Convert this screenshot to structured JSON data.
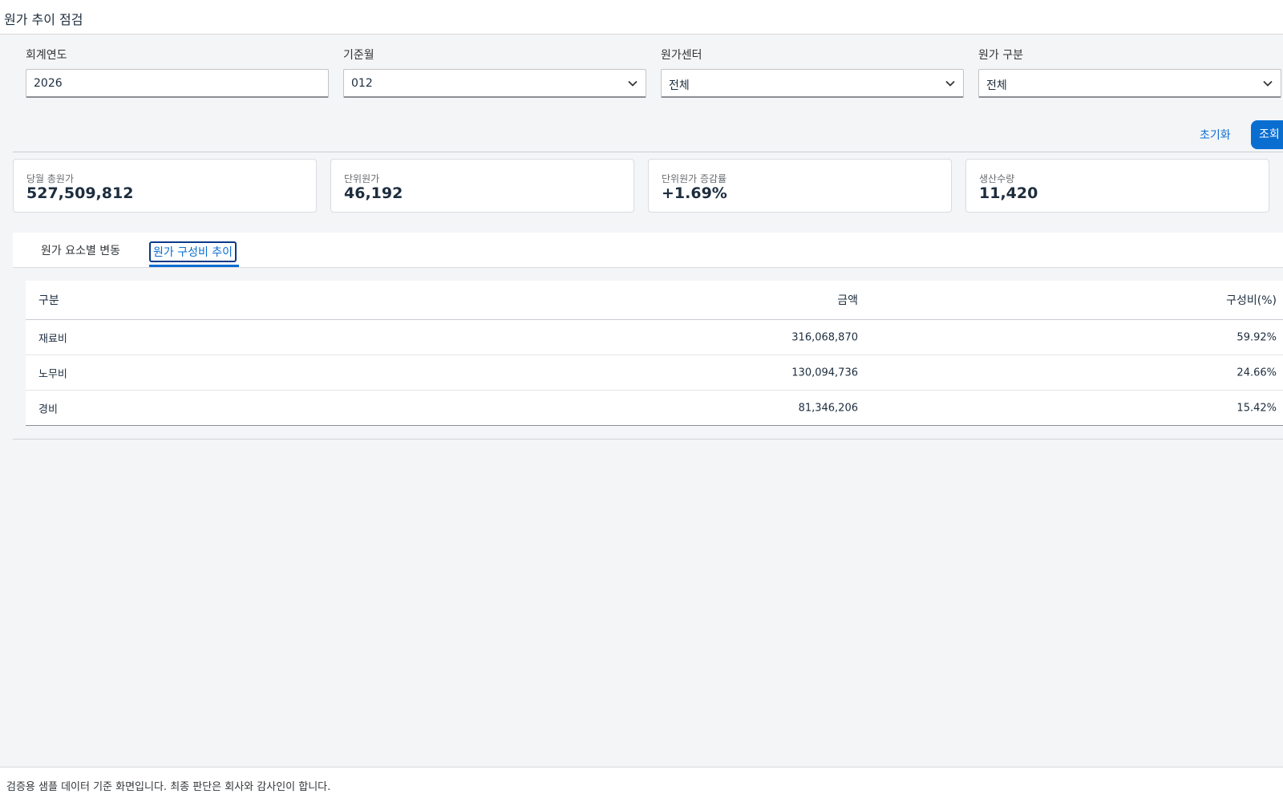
{
  "app": {
    "title": "원가 추이 점검"
  },
  "filters": {
    "fiscal_year": {
      "label": "회계연도",
      "value": "2026"
    },
    "base_month": {
      "label": "기준월",
      "value": "012"
    },
    "cost_center": {
      "label": "원가센터",
      "value": "전체"
    },
    "cost_type": {
      "label": "원가 구분",
      "value": "전체"
    }
  },
  "actions": {
    "reset_label": "초기화",
    "search_label": "조회"
  },
  "kpis": [
    {
      "label": "당월 총원가",
      "value": "527,509,812"
    },
    {
      "label": "단위원가",
      "value": "46,192"
    },
    {
      "label": "단위원가 증감률",
      "value": "+1.69%"
    },
    {
      "label": "생산수량",
      "value": "11,420"
    }
  ],
  "tabs": [
    {
      "label": "원가 요소별 변동",
      "selected": false
    },
    {
      "label": "원가 구성비 추이",
      "selected": true
    }
  ],
  "table": {
    "headers": [
      "구분",
      "금액",
      "구성비(%)"
    ],
    "rows": [
      {
        "category": "재료비",
        "amount": "316,068,870",
        "ratio": "59.92%"
      },
      {
        "category": "노무비",
        "amount": "130,094,736",
        "ratio": "24.66%"
      },
      {
        "category": "경비",
        "amount": "81,346,206",
        "ratio": "15.42%"
      }
    ]
  },
  "footer": {
    "note": "검증용 샘플 데이터 기준 화면입니다. 최종 판단은 회사와 감사인이 합니다."
  },
  "colors": {
    "accent": "#0a6ed1",
    "background": "#f4f5f7"
  },
  "icons": {
    "dropdown": "chevron-down-icon"
  }
}
